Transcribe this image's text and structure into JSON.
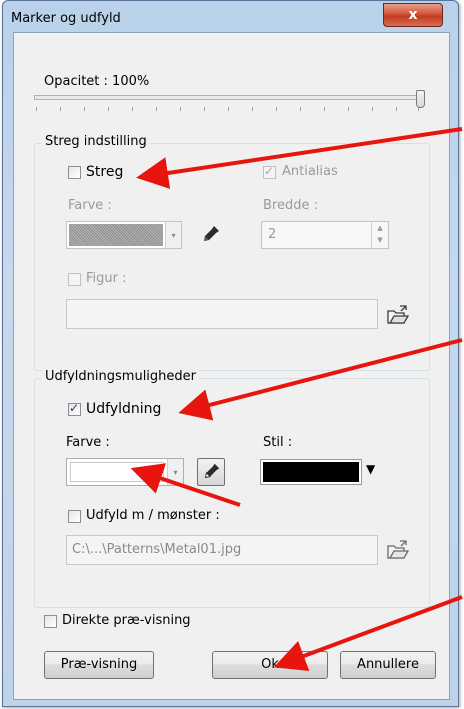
{
  "window": {
    "title": "Marker og udfyld",
    "close_glyph": "x"
  },
  "opacity": {
    "label": "Opacitet : 100%",
    "value_percent": 100
  },
  "stroke_group": {
    "title": "Streg indstilling",
    "stroke_checkbox": {
      "label": "Streg",
      "checked": false
    },
    "antialias_checkbox": {
      "label": "Antialias",
      "checked": true,
      "disabled": true
    },
    "color_label": "Farve :",
    "width_label": "Bredde :",
    "width_value": "2",
    "figure_checkbox": {
      "label": "Figur :",
      "checked": false,
      "disabled": true
    },
    "figure_path": ""
  },
  "fill_group": {
    "title": "Udfyldningsmuligheder",
    "fill_checkbox": {
      "label": "Udfyldning",
      "checked": true
    },
    "color_label": "Farve :",
    "style_label": "Stil :",
    "style_swatch_color": "#000000",
    "pattern_checkbox": {
      "label": "Udfyld m / mønster :",
      "checked": false
    },
    "pattern_path": "C:\\...\\Patterns\\Metal01.jpg"
  },
  "preview_checkbox": {
    "label": "Direkte præ-visning",
    "checked": false
  },
  "buttons": {
    "preview": "Præ-visning",
    "ok": "Ok",
    "cancel": "Annullere"
  },
  "icons": {
    "pipette": "eyedropper-icon",
    "folder": "open-folder-icon",
    "dropdown": "chevron-down-icon",
    "spin": "spinner-arrows-icon"
  },
  "colors": {
    "annotation_arrow": "#e8140e",
    "title_bar": "#b9d1ea",
    "close_button": "#c8432a"
  }
}
